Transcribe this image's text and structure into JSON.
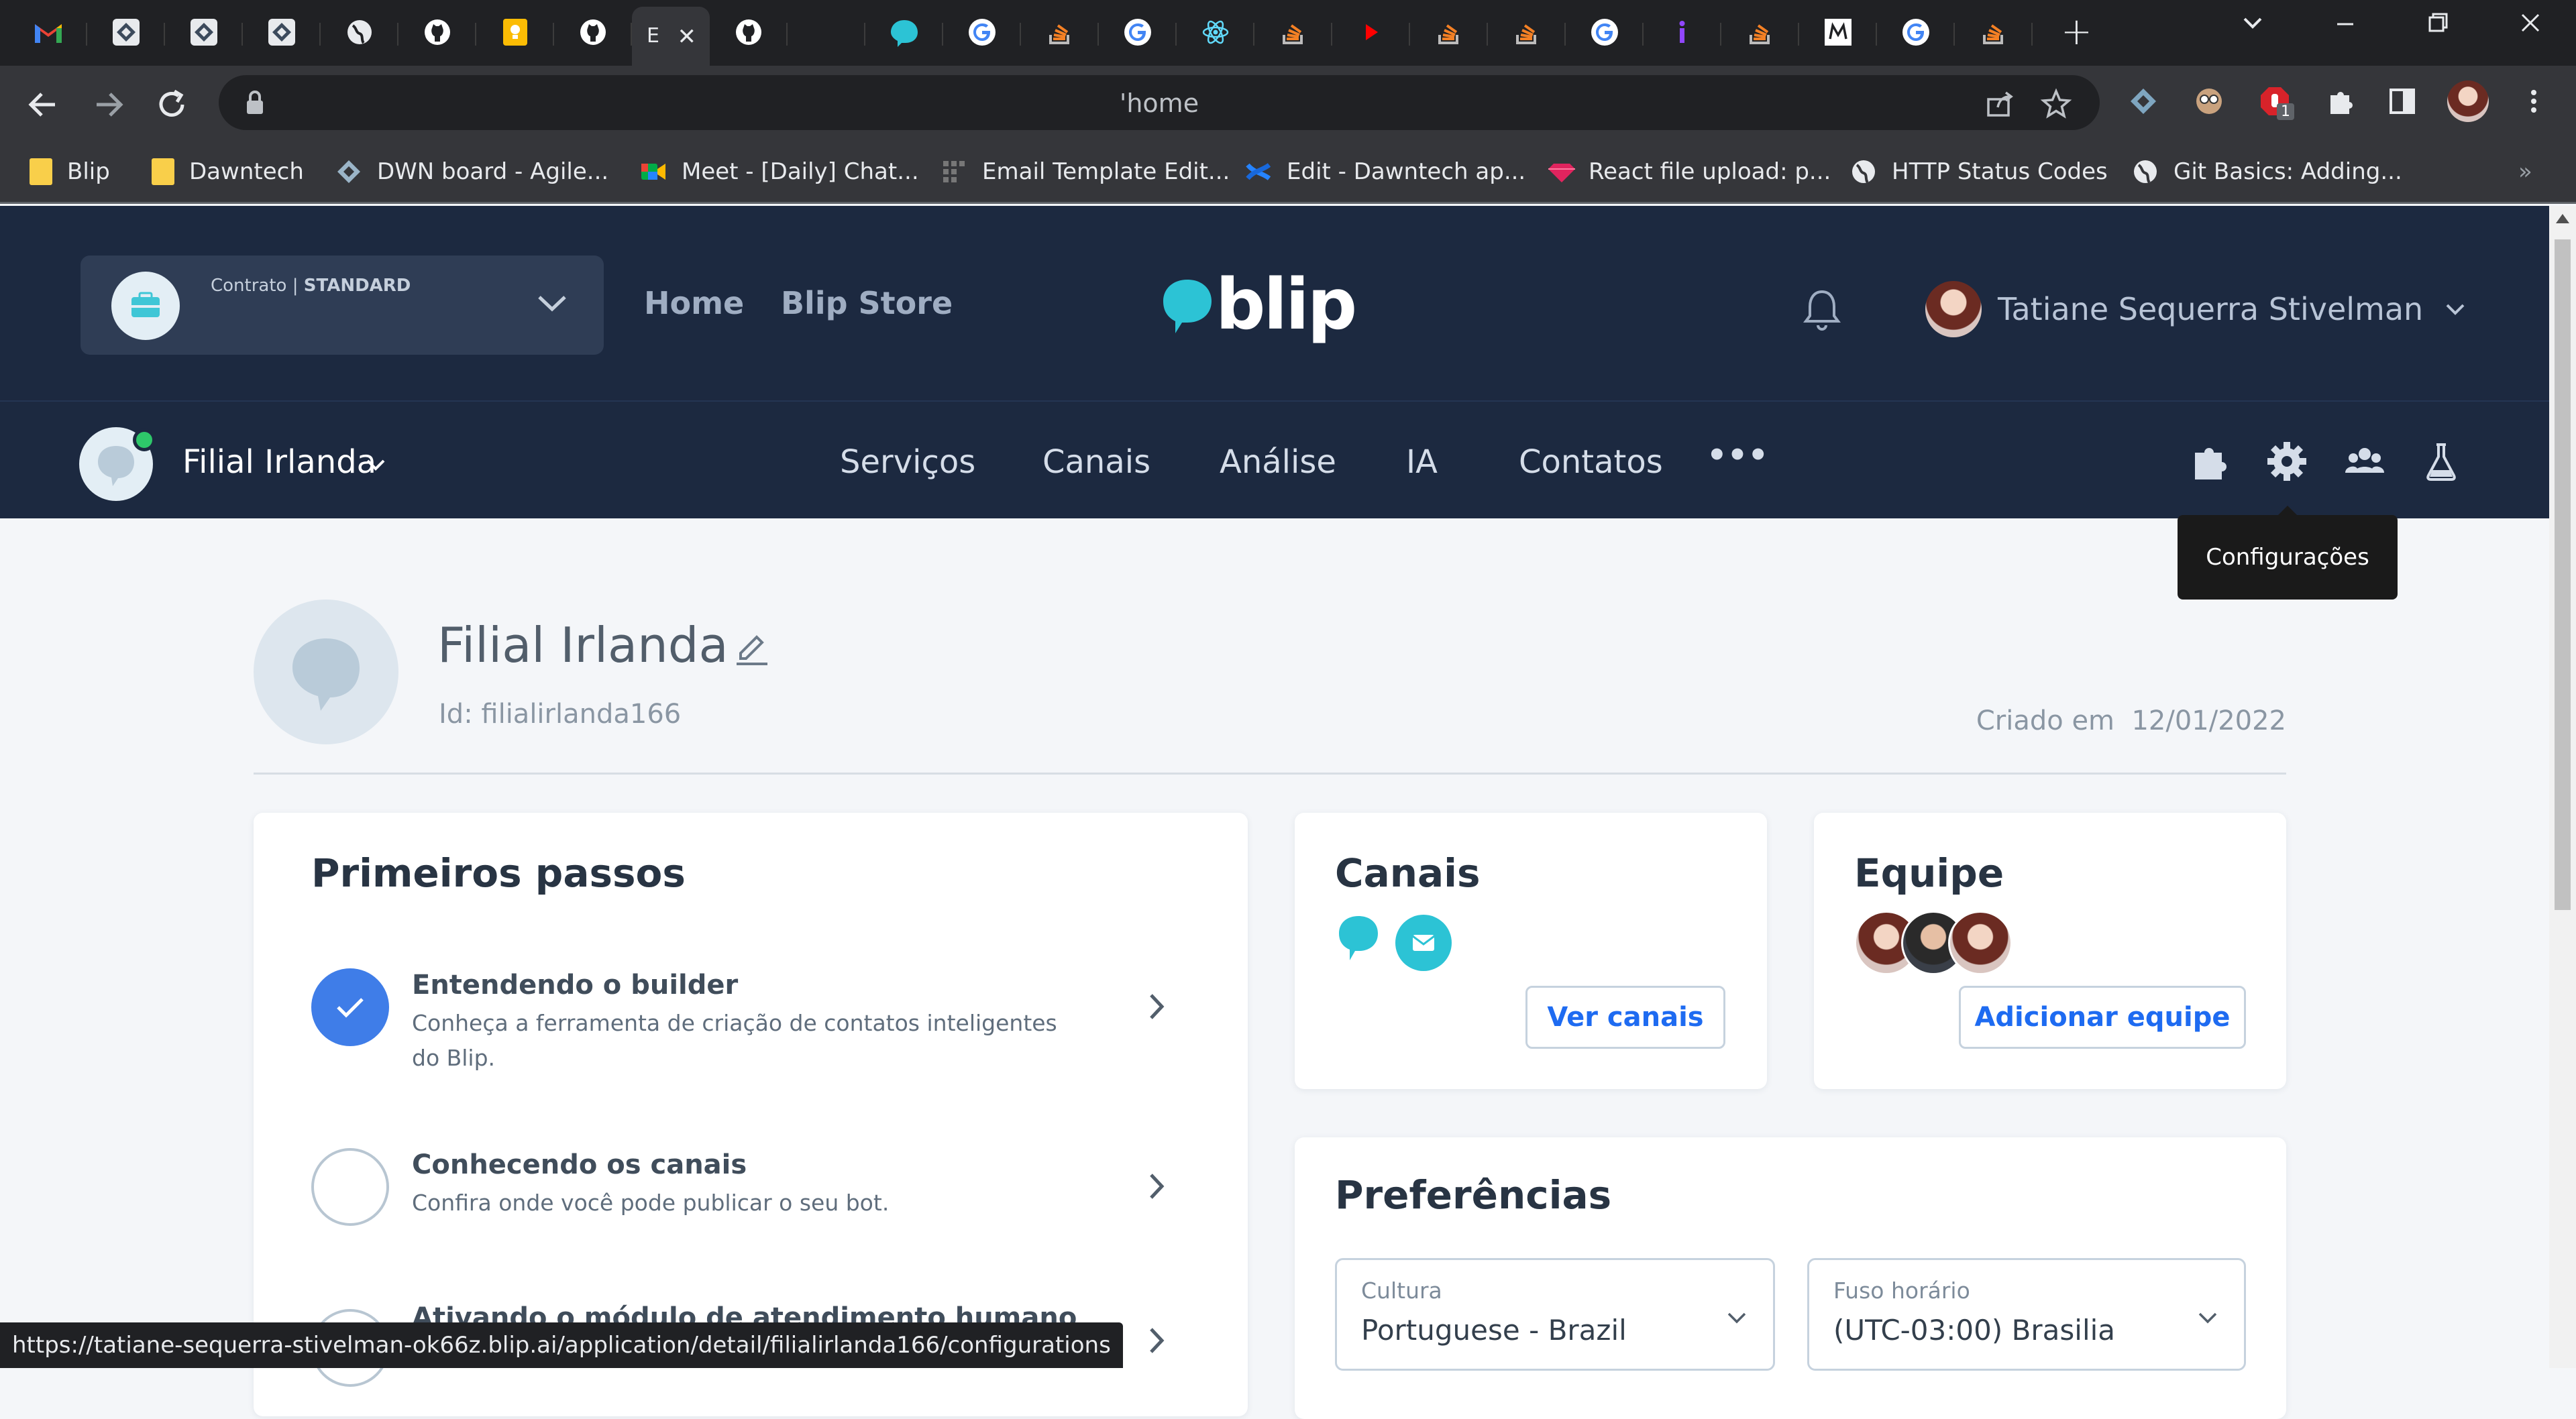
{
  "browser": {
    "tabs": [
      {
        "icon": "gmail-icon"
      },
      {
        "icon": "blip-portal-icon"
      },
      {
        "icon": "blip-portal-icon"
      },
      {
        "icon": "blip-portal-icon"
      },
      {
        "icon": "globe-icon"
      },
      {
        "icon": "github-icon"
      },
      {
        "icon": "keep-icon"
      },
      {
        "icon": "github-icon"
      },
      {
        "icon": "active-tab",
        "text": "E",
        "active": true
      },
      {
        "icon": "github-icon"
      },
      {
        "icon": "empty-icon"
      },
      {
        "icon": "blip-icon"
      },
      {
        "icon": "google-icon"
      },
      {
        "icon": "stackoverflow-icon"
      },
      {
        "icon": "google-icon"
      },
      {
        "icon": "react-icon"
      },
      {
        "icon": "stackoverflow-icon"
      },
      {
        "icon": "play-icon"
      },
      {
        "icon": "stackoverflow-icon"
      },
      {
        "icon": "stackoverflow-icon"
      },
      {
        "icon": "google-icon"
      },
      {
        "icon": "info-icon"
      },
      {
        "icon": "stackoverflow-icon"
      },
      {
        "icon": "medium-icon"
      },
      {
        "icon": "google-icon"
      },
      {
        "icon": "stackoverflow-icon"
      }
    ],
    "active_tab_close": "✕",
    "new_tab": "+",
    "address": "'home",
    "bookmarks": [
      "Blip",
      "Dawntech",
      "DWN board - Agile...",
      "Meet - [Daily] Chat...",
      "Email Template Edit...",
      "Edit - Dawntech ap...",
      "React file upload: p...",
      "HTTP Status Codes",
      "Git Basics: Adding..."
    ],
    "status_url": "https://tatiane-sequerra-stivelman-ok66z.blip.ai/application/detail/filialirlanda166/configurations",
    "extension_badge": "1"
  },
  "header": {
    "contract_prefix": "Contrato | ",
    "contract_plan": "STANDARD",
    "nav": [
      "Home",
      "Blip Store"
    ],
    "logo_text": "blip",
    "user_name": "Tatiane Sequerra Stivelman"
  },
  "botnav": {
    "bot_name": "Filial Irlanda",
    "items": [
      "Serviços",
      "Canais",
      "Análise",
      "IA",
      "Contatos"
    ],
    "more": "•••",
    "tooltip": "Configurações"
  },
  "bot": {
    "title": "Filial Irlanda",
    "id_label": "Id: filialirlanda166",
    "created_label": "Criado em",
    "created_date": "12/01/2022"
  },
  "first_steps": {
    "title": "Primeiros passos",
    "steps": [
      {
        "title": "Entendendo o builder",
        "desc": "Conheça a ferramenta de criação de contatos inteligentes do Blip.",
        "done": true
      },
      {
        "title": "Conhecendo os canais",
        "desc": "Confira onde você pode publicar o seu bot.",
        "done": false
      },
      {
        "title": "Ativando o módulo de atendimento humano",
        "desc": "",
        "done": false
      }
    ]
  },
  "channels": {
    "title": "Canais",
    "button": "Ver canais"
  },
  "team": {
    "title": "Equipe",
    "button": "Adicionar equipe"
  },
  "preferences": {
    "title": "Preferências",
    "culture_label": "Cultura",
    "culture_value": "Portuguese - Brazil",
    "timezone_label": "Fuso horário",
    "timezone_value": "(UTC-03:00) Brasilia"
  },
  "colors": {
    "brand": "#2cc3d5",
    "header_bg": "#1c2940",
    "link": "#1e6bf1",
    "check": "#3f7de8"
  }
}
